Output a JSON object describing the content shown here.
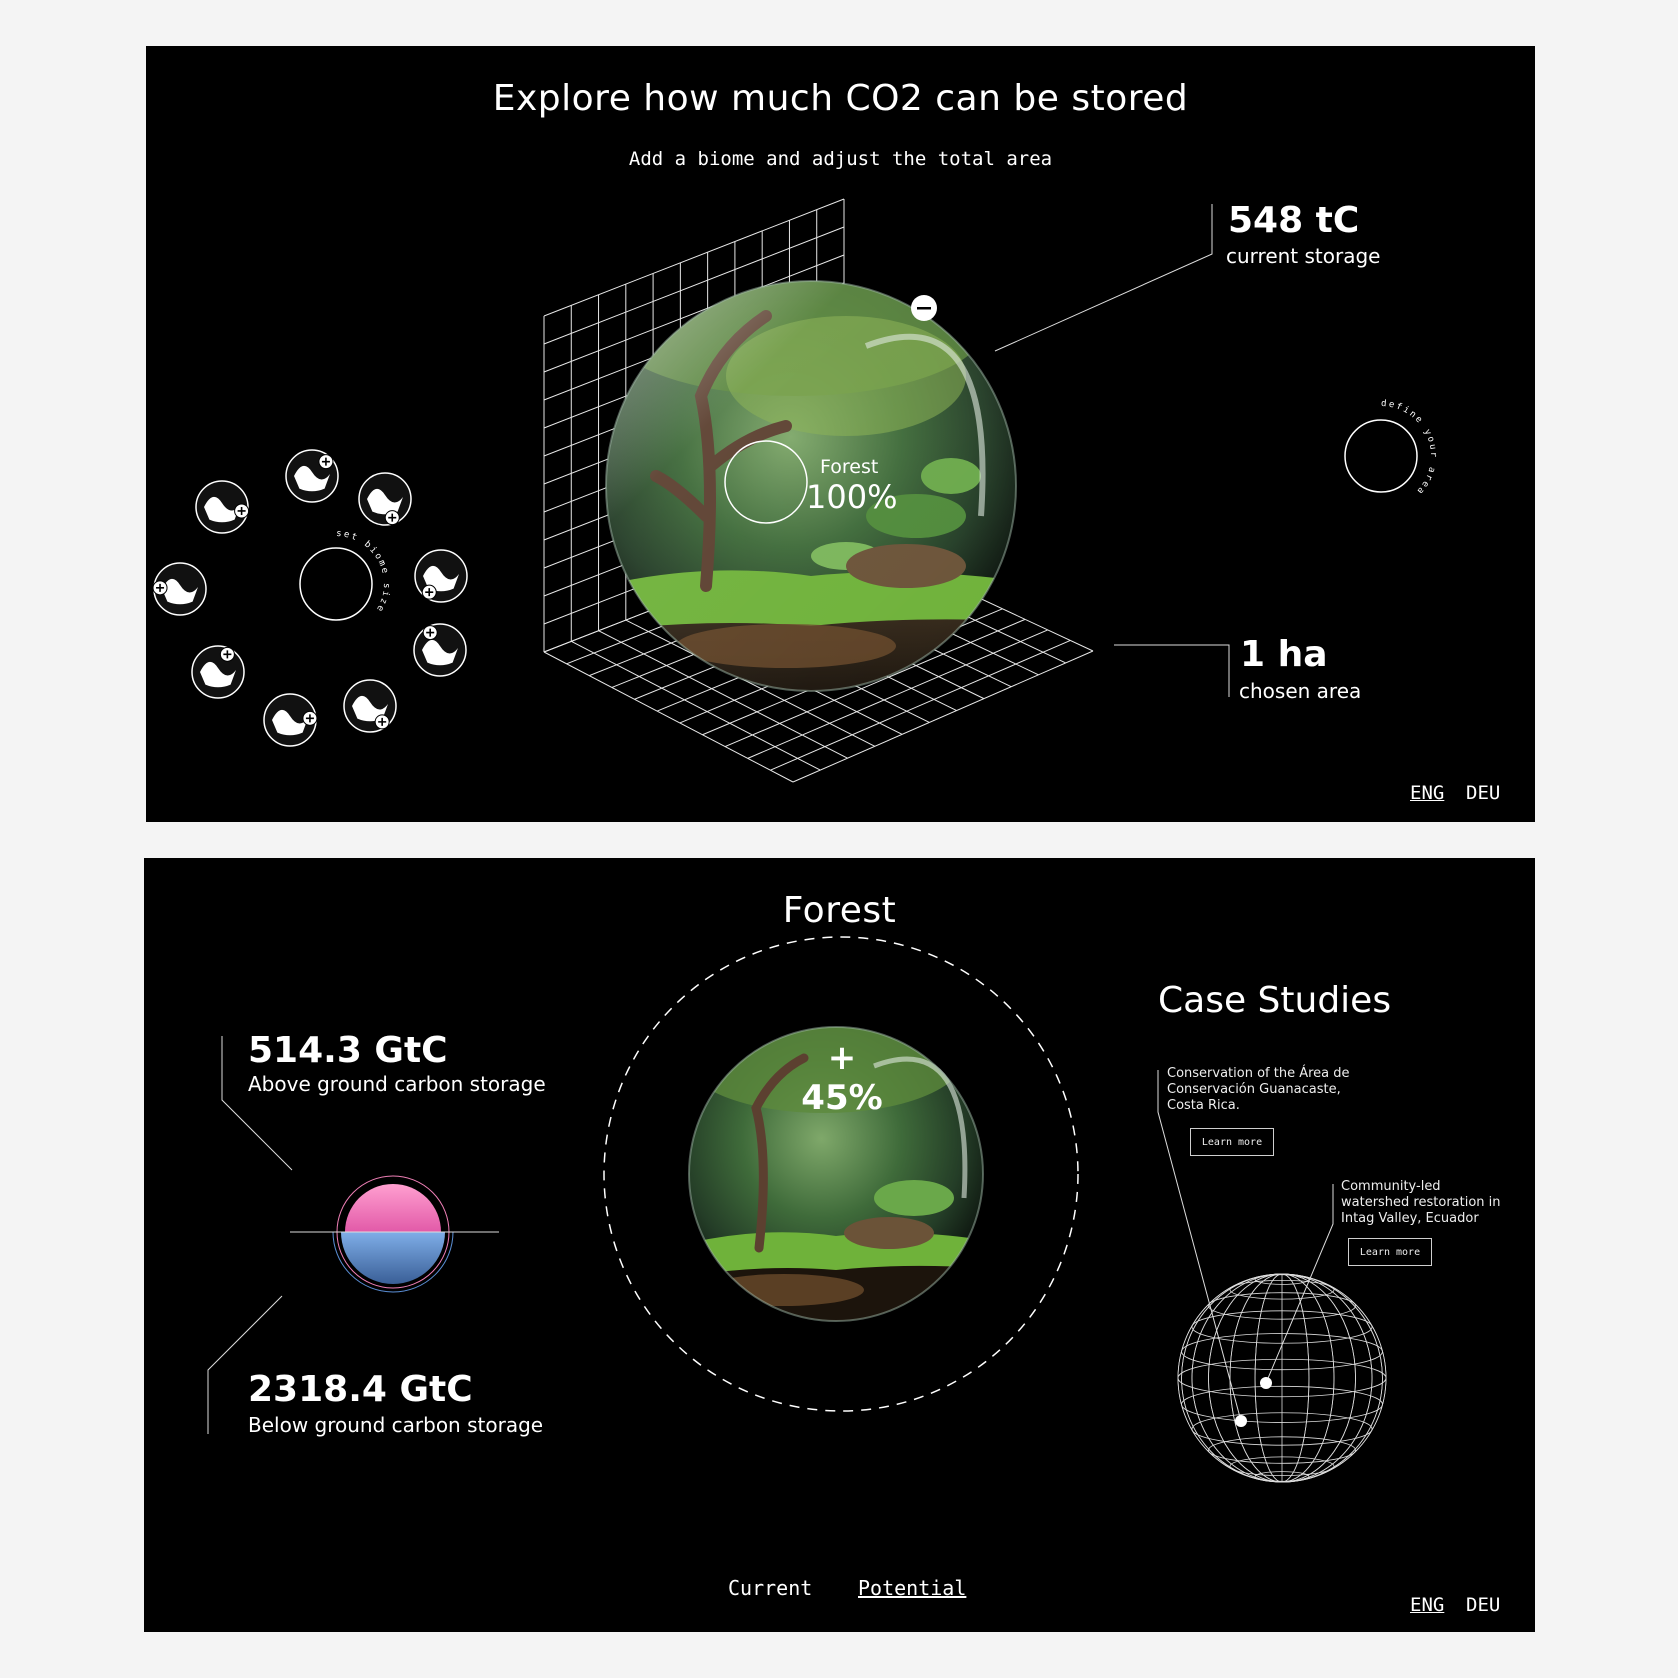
{
  "panel1": {
    "title": "Explore how much CO2 can be stored",
    "subtitle": "Add a biome and adjust the total area",
    "storage_value": "548 tC",
    "storage_label": "current storage",
    "area_value": "1 ha",
    "area_label": "chosen area",
    "biome_name": "Forest",
    "biome_share": "100%",
    "define_area_text": "define your area",
    "biome_size_text": "set biome size",
    "lang_eng": "ENG",
    "lang_deu": "DEU",
    "biome_icons": [
      "grassland-icon",
      "mangrove-icon",
      "peatland-icon",
      "desert-icon",
      "tundra-icon",
      "wetland-icon",
      "savanna-icon",
      "kelp-icon",
      "forest-icon"
    ]
  },
  "panel2": {
    "title": "Forest",
    "above_value": "514.3 GtC",
    "above_label": "Above ground carbon storage",
    "below_value": "2318.4 GtC",
    "below_label": "Below ground carbon storage",
    "growth": "+ 45%",
    "case_title": "Case Studies",
    "case1_text": "Conservation of the Área de Conservación Guanacaste, Costa Rica.",
    "case1_button": "Learn more",
    "case2_text": "Community-led watershed restoration in Intag Valley, Ecuador",
    "case2_button": "Learn more",
    "tab_current": "Current",
    "tab_potential": "Potential",
    "lang_eng": "ENG",
    "lang_deu": "DEU"
  },
  "colors": {
    "background": "#000000",
    "page": "#f4f4f4",
    "above_ground": "#ee7fb6",
    "below_ground": "#5b8fd6",
    "moss": "#6fb23a"
  }
}
